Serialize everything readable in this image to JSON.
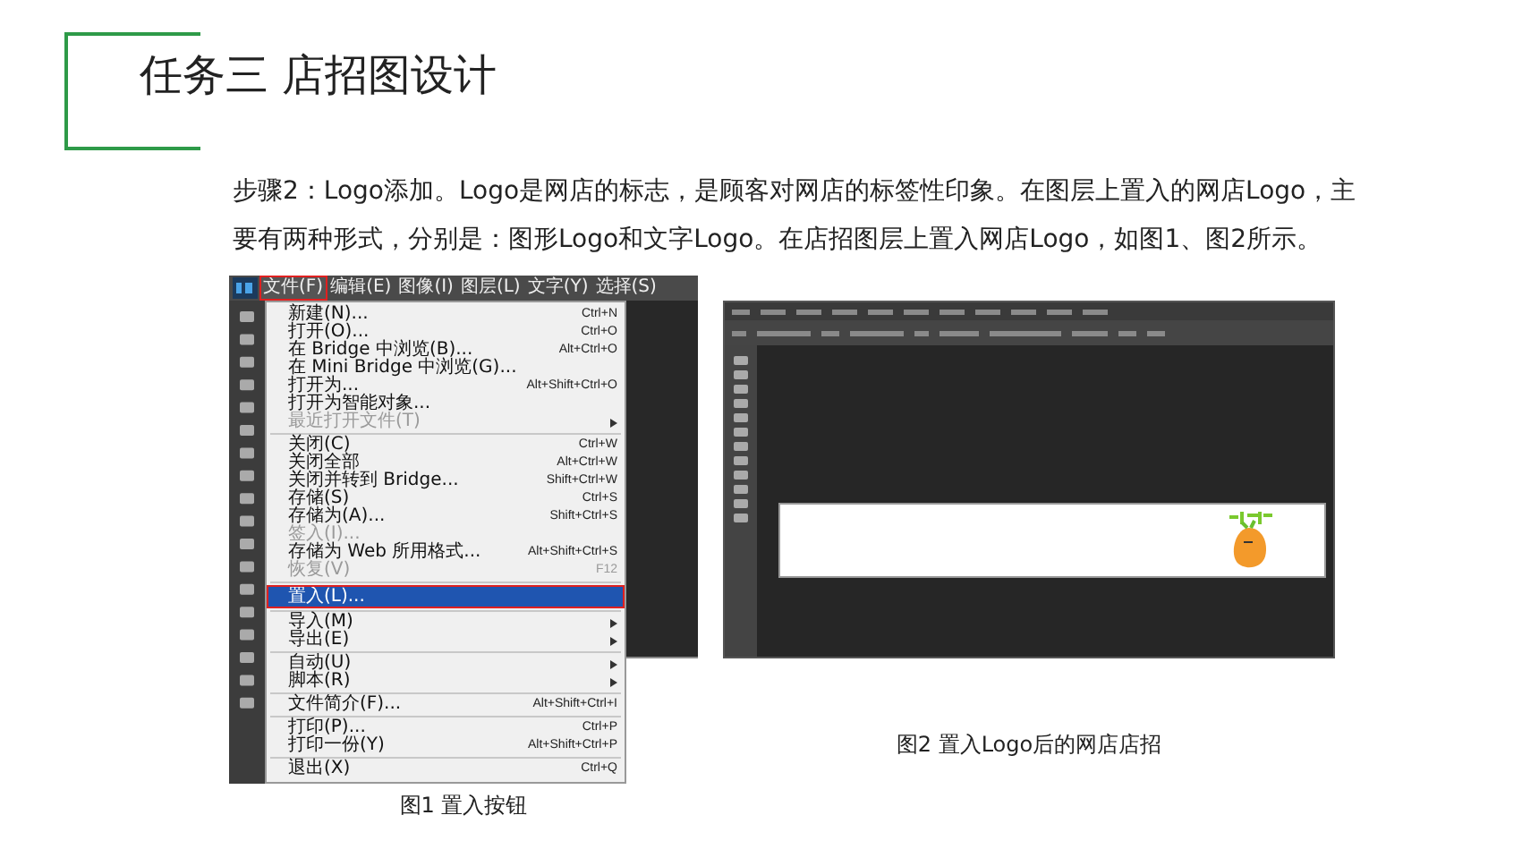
{
  "title": "任务三 店招图设计",
  "paragraph": "步骤2：Logo添加。Logo是网店的标志，是顾客对网店的标签性印象。在图层上置入的网店Logo，主要有两种形式，分别是：图形Logo和文字Logo。在店招图层上置入网店Logo，如图1、图2所示。",
  "figure_1": {
    "menu_bar": [
      {
        "label": "文件(F)",
        "selected": true
      },
      {
        "label": "编辑(E)",
        "selected": false
      },
      {
        "label": "图像(I)",
        "selected": false
      },
      {
        "label": "图层(L)",
        "selected": false
      },
      {
        "label": "文字(Y)",
        "selected": false
      },
      {
        "label": "选择(S)",
        "selected": false
      }
    ],
    "menu": [
      {
        "kind": "item",
        "label": "新建(N)...",
        "shortcut": "Ctrl+N",
        "disabled": false,
        "selected": false,
        "submenu": false
      },
      {
        "kind": "item",
        "label": "打开(O)...",
        "shortcut": "Ctrl+O",
        "disabled": false,
        "selected": false,
        "submenu": false
      },
      {
        "kind": "item",
        "label": "在 Bridge 中浏览(B)...",
        "shortcut": "Alt+Ctrl+O",
        "disabled": false,
        "selected": false,
        "submenu": false
      },
      {
        "kind": "item",
        "label": "在 Mini Bridge 中浏览(G)...",
        "disabled": false,
        "selected": false,
        "submenu": false
      },
      {
        "kind": "item",
        "label": "打开为...",
        "shortcut": "Alt+Shift+Ctrl+O",
        "disabled": false,
        "selected": false,
        "submenu": false
      },
      {
        "kind": "item",
        "label": "打开为智能对象...",
        "disabled": false,
        "selected": false,
        "submenu": false
      },
      {
        "kind": "item",
        "label": "最近打开文件(T)",
        "disabled": true,
        "selected": false,
        "submenu": true
      },
      {
        "kind": "separator"
      },
      {
        "kind": "item",
        "label": "关闭(C)",
        "shortcut": "Ctrl+W",
        "disabled": false,
        "selected": false,
        "submenu": false
      },
      {
        "kind": "item",
        "label": "关闭全部",
        "shortcut": "Alt+Ctrl+W",
        "disabled": false,
        "selected": false,
        "submenu": false
      },
      {
        "kind": "item",
        "label": "关闭并转到 Bridge...",
        "shortcut": "Shift+Ctrl+W",
        "disabled": false,
        "selected": false,
        "submenu": false
      },
      {
        "kind": "item",
        "label": "存储(S)",
        "shortcut": "Ctrl+S",
        "disabled": false,
        "selected": false,
        "submenu": false
      },
      {
        "kind": "item",
        "label": "存储为(A)...",
        "shortcut": "Shift+Ctrl+S",
        "disabled": false,
        "selected": false,
        "submenu": false
      },
      {
        "kind": "item",
        "label": "签入(I)...",
        "disabled": true,
        "selected": false,
        "submenu": false
      },
      {
        "kind": "item",
        "label": "存储为 Web 所用格式...",
        "shortcut": "Alt+Shift+Ctrl+S",
        "disabled": false,
        "selected": false,
        "submenu": false
      },
      {
        "kind": "item",
        "label": "恢复(V)",
        "shortcut": "F12",
        "disabled": true,
        "selected": false,
        "submenu": false
      },
      {
        "kind": "separator"
      },
      {
        "kind": "item",
        "label": "置入(L)...",
        "disabled": false,
        "selected": true,
        "submenu": false
      },
      {
        "kind": "separator"
      },
      {
        "kind": "item",
        "label": "导入(M)",
        "disabled": false,
        "selected": false,
        "submenu": true
      },
      {
        "kind": "item",
        "label": "导出(E)",
        "disabled": false,
        "selected": false,
        "submenu": true
      },
      {
        "kind": "separator"
      },
      {
        "kind": "item",
        "label": "自动(U)",
        "disabled": false,
        "selected": false,
        "submenu": true
      },
      {
        "kind": "item",
        "label": "脚本(R)",
        "disabled": false,
        "selected": false,
        "submenu": true
      },
      {
        "kind": "separator"
      },
      {
        "kind": "item",
        "label": "文件简介(F)...",
        "shortcut": "Alt+Shift+Ctrl+I",
        "disabled": false,
        "selected": false,
        "submenu": false
      },
      {
        "kind": "separator"
      },
      {
        "kind": "item",
        "label": "打印(P)...",
        "shortcut": "Ctrl+P",
        "disabled": false,
        "selected": false,
        "submenu": false
      },
      {
        "kind": "item",
        "label": "打印一份(Y)",
        "shortcut": "Alt+Shift+Ctrl+P",
        "disabled": false,
        "selected": false,
        "submenu": false
      },
      {
        "kind": "separator"
      },
      {
        "kind": "item",
        "label": "退出(X)",
        "shortcut": "Ctrl+Q",
        "disabled": false,
        "selected": false,
        "submenu": false
      }
    ],
    "caption": "图1 置入按钮"
  },
  "figure_2": {
    "caption": "图2  置入Logo后的网店店招"
  }
}
